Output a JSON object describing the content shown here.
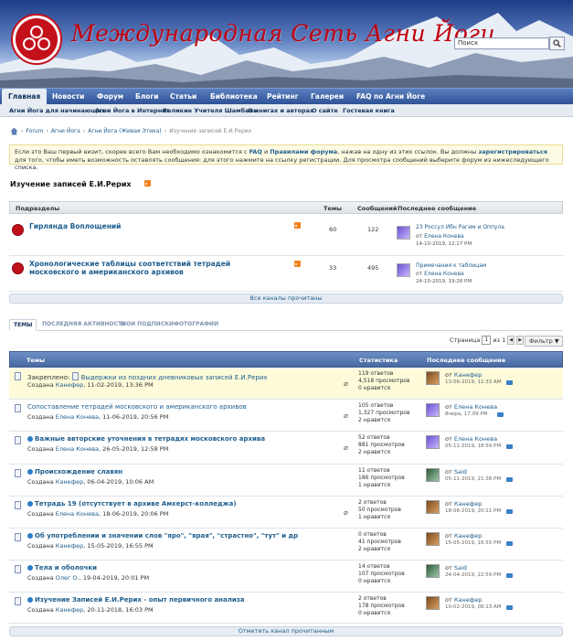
{
  "site": {
    "title": "Международная Сеть Агни Йоги"
  },
  "search": {
    "placeholder": "Поиск"
  },
  "nav": {
    "items": [
      "Главная",
      "Новости",
      "Форум",
      "Блоги",
      "Статьи",
      "Библиотека",
      "Рейтинг",
      "Галереи",
      "FAQ по Агни Йоге"
    ]
  },
  "subnav": {
    "items": [
      "Агни Йога для начинающих",
      "Агни Йога в Интернет",
      "Великие Учителя Шамбалы",
      "О книгах и авторах",
      "О сайте",
      "Гостевая книга"
    ]
  },
  "breadcrumb": [
    "Forum",
    "Агни Йога",
    "Агни Йога (Живая Этика)",
    "Изучение записей Е.И.Рерих"
  ],
  "notice": {
    "p1": "Если это Ваш первый визит, скорее всего Вам необходимо ознакомится с ",
    "faq": "FAQ",
    "and": " и ",
    "rules": "Правилами форума",
    "p2": ", нажав на одну из этих ссылок. Вы должны ",
    "register": "зарегистрироваться",
    "p3": " для того, чтобы иметь возможность оставлять сообщения: для этого нажмите на ссылку регистрации. Для просмотра сообщений выберите форум из нижеследующего списка."
  },
  "page": {
    "title": "Изучение записей Е.И.Рерих"
  },
  "subforums": {
    "headers": {
      "name": "Подразделы",
      "threads": "Темы",
      "posts": "Сообщений",
      "last": "Последнее сообщение"
    },
    "rows": [
      {
        "name": "Гирлянда Воплощений",
        "threads": "60",
        "posts": "122",
        "last_title": "23 Россул Ибн Рагим и Оппула",
        "last_by": "Елена Конева",
        "last_date": "14-10-2019, 12:17 PM"
      },
      {
        "name": "Хронологические таблицы соответствий тетрадей московского и американского архивов",
        "threads": "33",
        "posts": "495",
        "last_title": "Примечания к таблицам",
        "last_by": "Елена Конева",
        "last_date": "24-10-2019, 19:28 PM"
      }
    ],
    "mark_read": "Все каналы прочитаны"
  },
  "tabs": [
    "ТЕМЫ",
    "ПОСЛЕДНЯЯ АКТИВНОСТЬ",
    "МОИ ПОДПИСКИ",
    "ФОТОГРАФИИ"
  ],
  "pager": {
    "label": "Страница",
    "current": "1",
    "of": "из 1"
  },
  "filter": {
    "label": "Фильтр"
  },
  "topics": {
    "headers": {
      "title": "Темы",
      "stats": "Статистика",
      "last": "Последнее сообщение"
    },
    "rows": [
      {
        "prefix": "Закреплено: ",
        "title": "Выдержки из поздних дневниковых записей Е.И.Рерих",
        "started_label": "Создана ",
        "author": "Канефер",
        "date": ", 11-02-2019, 13:36 PM",
        "replies": "119 ответов",
        "views": "4,518 просмотров",
        "likes": "0 нравится",
        "last_by_label": "от ",
        "last_by": "Канефер",
        "last_date": "13-06-2019, 11:33 AM"
      },
      {
        "prefix": "",
        "title": "Сопоставление тетрадей московского и американского архивов",
        "started_label": "Создана ",
        "author": "Елена Конева",
        "date": ", 11-06-2019, 20:56 PM",
        "replies": "105 ответов",
        "views": "1,327 просмотров",
        "likes": "2 нравится",
        "last_by_label": "от ",
        "last_by": "Елена Конева",
        "last_date": "Вчера, 17:09 PM"
      },
      {
        "prefix": "",
        "title": "Важные авторские уточнения в тетрадях московского архива",
        "started_label": "Создана ",
        "author": "Елена Конева",
        "date": ", 26-05-2019, 12:58 PM",
        "replies": "52 ответов",
        "views": "881 просмотров",
        "likes": "2 нравится",
        "last_by_label": "от ",
        "last_by": "Елена Конева",
        "last_date": "05-11-2019, 18:59 PM"
      },
      {
        "prefix": "",
        "title": "Происхождение славян",
        "started_label": "Создана ",
        "author": "Канефер",
        "date": ", 06-04-2019, 10:06 AM",
        "replies": "11 ответов",
        "views": "186 просмотров",
        "likes": "1 нравится",
        "last_by_label": "от ",
        "last_by": "Said",
        "last_date": "05-11-2019, 21:38 PM"
      },
      {
        "prefix": "",
        "title": "Тетрадь 19 (отсутствует в архиве Амхерст-колледжа)",
        "started_label": "Создана ",
        "author": "Елена Конева",
        "date": ", 18-06-2019, 20:06 PM",
        "replies": "2 ответов",
        "views": "50 просмотров",
        "likes": "1 нравится",
        "last_by_label": "от ",
        "last_by": "Канефер",
        "last_date": "18-06-2019, 20:11 PM"
      },
      {
        "prefix": "",
        "title": "Об употреблении и значении слов \"яро\", \"ярая\", \"страстно\", \"тут\" и др",
        "started_label": "Создана ",
        "author": "Канефер",
        "date": ", 15-05-2019, 16:55 PM",
        "replies": "0 ответов",
        "views": "41 просмотров",
        "likes": "2 нравится",
        "last_by_label": "от ",
        "last_by": "Канефер",
        "last_date": "15-05-2019, 16:55 PM"
      },
      {
        "prefix": "",
        "title": "Тела и оболочки",
        "started_label": "Создана ",
        "author": "Олег О.",
        "date": ", 19-04-2019, 20:01 PM",
        "replies": "14 ответов",
        "views": "107 просмотров",
        "likes": "0 нравится",
        "last_by_label": "от ",
        "last_by": "Said",
        "last_date": "24-04-2019, 22:59 PM"
      },
      {
        "prefix": "",
        "title": "Изучение Записей Е.И.Рерих - опыт первичного анализа",
        "started_label": "Создана ",
        "author": "Канефер",
        "date": ", 20-11-2018, 16:03 PM",
        "replies": "2 ответов",
        "views": "178 просмотров",
        "likes": "0 нравится",
        "last_by_label": "от ",
        "last_by": "Канефер",
        "last_date": "10-02-2019, 08:13 AM"
      }
    ],
    "mark_read": "Отметить канал прочитанным"
  }
}
